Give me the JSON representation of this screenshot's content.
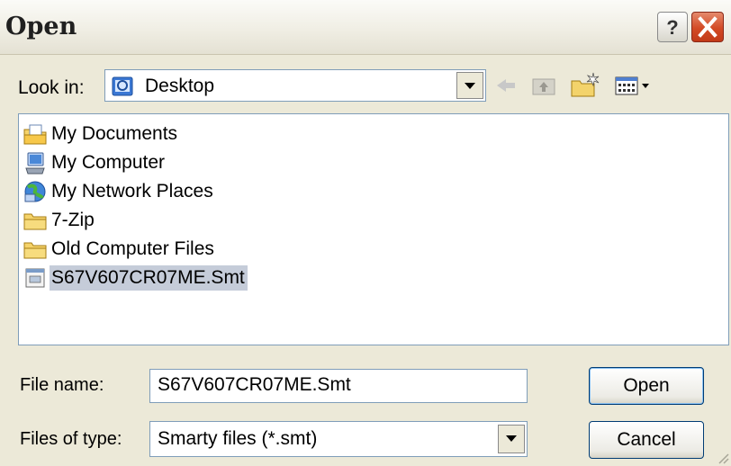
{
  "window": {
    "title": "Open",
    "help_glyph": "?",
    "close_icon": "close-icon"
  },
  "toolbar": {
    "lookin_label": "Look in:",
    "lookin_value": "Desktop",
    "lookin_icon": "desktop-icon",
    "back_icon": "back-arrow-icon",
    "up_icon": "up-folder-icon",
    "new_folder_icon": "new-folder-icon",
    "views_icon": "views-menu-icon"
  },
  "files": [
    {
      "name": "My Documents",
      "icon": "my-documents-icon"
    },
    {
      "name": "My Computer",
      "icon": "my-computer-icon"
    },
    {
      "name": "My Network Places",
      "icon": "network-places-icon"
    },
    {
      "name": "7-Zip",
      "icon": "folder-icon"
    },
    {
      "name": "Old Computer Files",
      "icon": "folder-icon"
    },
    {
      "name": "S67V607CR07ME.Smt",
      "icon": "smt-file-icon",
      "selected": true
    }
  ],
  "form": {
    "filename_label": "File name:",
    "filename_value": "S67V607CR07ME.Smt",
    "filetype_label": "Files of type:",
    "filetype_value": "Smarty files (*.smt)"
  },
  "buttons": {
    "open": "Open",
    "cancel": "Cancel"
  },
  "colors": {
    "selection": "#c5ccd9",
    "dialog_bg": "#ece9d8",
    "close_red": "#d34a25"
  }
}
